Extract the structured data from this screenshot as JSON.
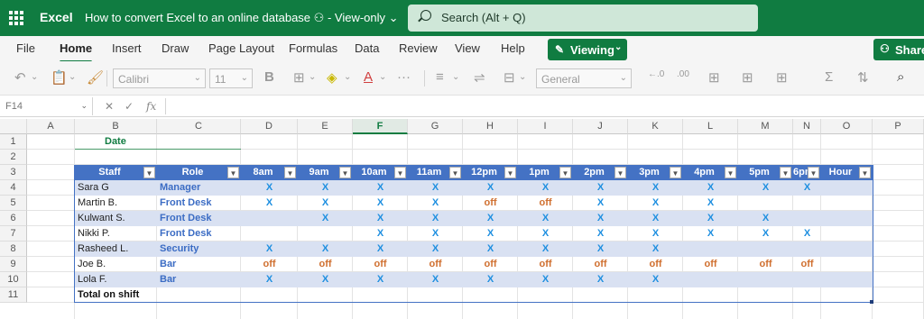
{
  "app": {
    "name": "Excel",
    "doc_title": "How to convert Excel to an online database",
    "doc_status": "View-only",
    "search_placeholder": "Search (Alt + Q)"
  },
  "ribbon": {
    "tabs": [
      "File",
      "Home",
      "Insert",
      "Draw",
      "Page Layout",
      "Formulas",
      "Data",
      "Review",
      "View",
      "Help"
    ],
    "active_tab": "Home",
    "viewing_label": "Viewing",
    "share_label": "Share"
  },
  "toolbar": {
    "font_name": "Calibri",
    "font_size": "11",
    "number_format": "General"
  },
  "formula_bar": {
    "name_box": "F14",
    "fx": "fx"
  },
  "sheet": {
    "columns": [
      "A",
      "B",
      "C",
      "D",
      "E",
      "F",
      "G",
      "H",
      "I",
      "J",
      "K",
      "L",
      "M",
      "N",
      "O",
      "P"
    ],
    "selected_column": "F",
    "rows": [
      "1",
      "2",
      "3",
      "4",
      "5",
      "6",
      "7",
      "8",
      "9",
      "10",
      "11"
    ],
    "date_label": "Date",
    "table_headers": [
      "Staff",
      "Role",
      "8am",
      "9am",
      "10am",
      "11am",
      "12pm",
      "1pm",
      "2pm",
      "3pm",
      "4pm",
      "5pm",
      "6pm",
      "Hour"
    ],
    "table_rows": [
      {
        "staff": "Sara G",
        "role": "Manager",
        "slots": [
          "X",
          "X",
          "X",
          "X",
          "X",
          "X",
          "X",
          "X",
          "X",
          "X",
          "X"
        ]
      },
      {
        "staff": "Martin B.",
        "role": "Front Desk",
        "slots": [
          "X",
          "X",
          "X",
          "X",
          "off",
          "off",
          "X",
          "X",
          "X",
          "",
          ""
        ]
      },
      {
        "staff": "Kulwant S.",
        "role": "Front Desk",
        "slots": [
          "",
          "X",
          "X",
          "X",
          "X",
          "X",
          "X",
          "X",
          "X",
          "X",
          ""
        ]
      },
      {
        "staff": "Nikki P.",
        "role": "Front Desk",
        "slots": [
          "",
          "",
          "X",
          "X",
          "X",
          "X",
          "X",
          "X",
          "X",
          "X",
          "X"
        ]
      },
      {
        "staff": "Rasheed L.",
        "role": "Security",
        "slots": [
          "X",
          "X",
          "X",
          "X",
          "X",
          "X",
          "X",
          "X",
          "",
          "",
          ""
        ]
      },
      {
        "staff": "Joe B.",
        "role": "Bar",
        "slots": [
          "off",
          "off",
          "off",
          "off",
          "off",
          "off",
          "off",
          "off",
          "off",
          "off",
          "off"
        ]
      },
      {
        "staff": "Lola F.",
        "role": "Bar",
        "slots": [
          "X",
          "X",
          "X",
          "X",
          "X",
          "X",
          "X",
          "X",
          "",
          "",
          ""
        ]
      }
    ],
    "total_label": "Total on shift"
  },
  "colors": {
    "brand": "#107c41",
    "table_header": "#4472c4",
    "band": "#d9e1f2",
    "x_mark": "#1e8fe0",
    "off_mark": "#d07030"
  }
}
